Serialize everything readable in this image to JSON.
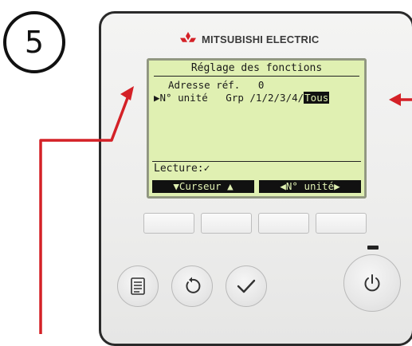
{
  "step": {
    "number": "5"
  },
  "brand": {
    "name": "MITSUBISHI ELECTRIC"
  },
  "lcd": {
    "title": "Réglage des fonctions",
    "line1": "Adresse réf.   0",
    "line2_prefix": "▶N° unité   Grp /1/2/3/4/",
    "line2_selected": "Tous",
    "status": "Lecture:✓",
    "softkey_left": "▼Curseur ▲",
    "softkey_right": "◀N° unité▶"
  },
  "buttons": {
    "function_keys": [
      "F1",
      "F2",
      "F3",
      "F4"
    ],
    "menu_icon": "menu-icon",
    "return_icon": "return-icon",
    "confirm_icon": "check-icon",
    "power_icon": "power-icon"
  },
  "colors": {
    "lcd_background": "#e0f0b2",
    "arrow": "#d42127",
    "logo": "#d42127"
  }
}
